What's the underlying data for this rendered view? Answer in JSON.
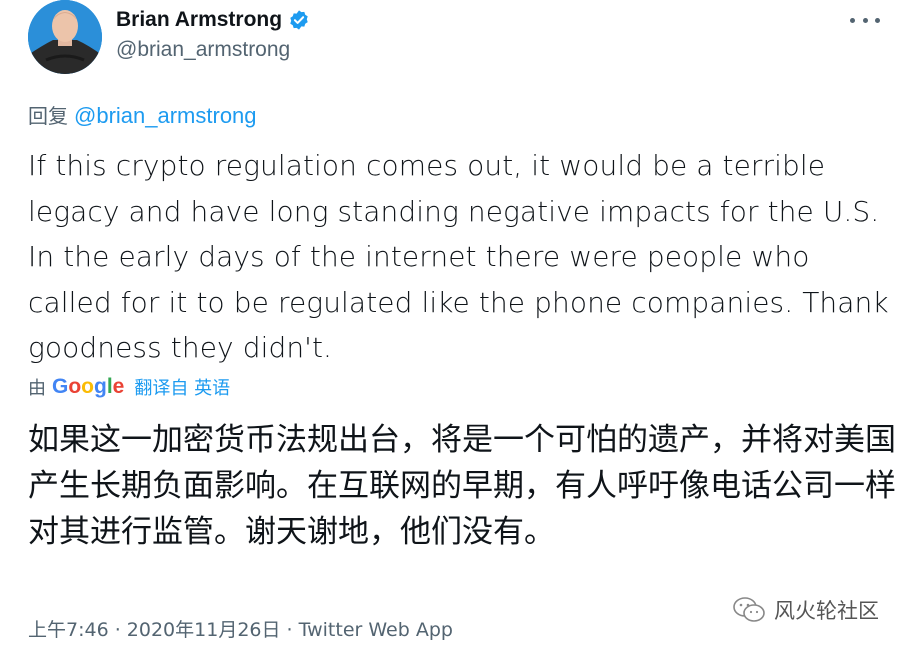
{
  "author": {
    "name": "Brian Armstrong",
    "handle": "@brian_armstrong",
    "verified": true
  },
  "reply": {
    "prefix": "回复",
    "mention": "@brian_armstrong"
  },
  "tweet_text": "If this crypto regulation comes out, it would be a terrible legacy and have long standing negative impacts for the U.S. In the early days of the internet there were people who called for it to be regulated like the phone companies. Thank goodness they didn't.",
  "translation": {
    "by_prefix": "由",
    "provider": "Google",
    "source_label": "翻译自 英语",
    "text": "如果这一加密货币法规出台，将是一个可怕的遗产，并将对美国产生长期负面影响。在互联网的早期，有人呼吁像电话公司一样对其进行监管。谢天谢地，他们没有。"
  },
  "meta": {
    "time": "上午7:46",
    "separator1": " · ",
    "date": "2020年11月26日",
    "separator2": " · ",
    "app": "Twitter Web App"
  },
  "watermark": {
    "text": "风火轮社区"
  },
  "colors": {
    "accent": "#1d9bf0",
    "secondary_text": "#536471",
    "primary_text": "#0f1419"
  },
  "icons": {
    "more": "more-horizontal-icon",
    "verified": "verified-badge-icon",
    "watermark": "wechat-icon"
  }
}
